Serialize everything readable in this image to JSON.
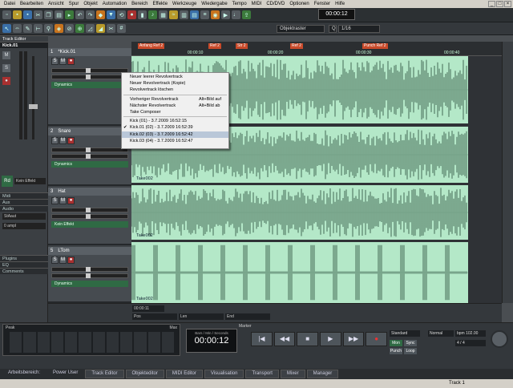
{
  "menu": [
    "Datei",
    "Bearbeiten",
    "Ansicht",
    "Spur",
    "Objekt",
    "Automation",
    "Bereich",
    "Effekte",
    "Werkzeuge",
    "Wiedergabe",
    "Tempo",
    "MIDI",
    "CD/DVD",
    "Optionen",
    "Fenster",
    "Hilfe"
  ],
  "toolbar": {
    "time": "00:00:12",
    "snap_label": "Objektraster",
    "quant_label": "Q",
    "quant_value": "1/16"
  },
  "track_editor": {
    "title": "Track Editor",
    "track_name": "Kick.01",
    "sections": [
      "Midi",
      "Aux",
      "Audio",
      "Plugins",
      "EQ",
      "Comments"
    ],
    "audio_value": "StAaut",
    "vol_value": "0 ampl",
    "kein_effekt": "Kein Effekt",
    "rd_label": "Rd"
  },
  "tracks": [
    {
      "num": "1",
      "name": "*Kick.01",
      "fx": "Dynamics"
    },
    {
      "num": "2",
      "name": "Snare",
      "fx": "Dynamics"
    },
    {
      "num": "3",
      "name": "Hat",
      "fx": "Kein Effekt"
    },
    {
      "num": "5",
      "name": "LTom",
      "fx": "Dynamics"
    }
  ],
  "markers": [
    "Anfang Ref 2",
    "Ref 2",
    "Str 2",
    "Ref 2",
    "Punch Ref 2"
  ],
  "ruler_ticks": [
    "00:00:10",
    "00:00:20",
    "00:00:30",
    "00:00:40"
  ],
  "takes": [
    "Take002",
    "Take002",
    "Take002",
    "Take002"
  ],
  "context_menu": [
    {
      "label": "Neuer leerer Revolvertrack",
      "shortcut": ""
    },
    {
      "label": "Neuer Revolvertrack (Kopie)",
      "shortcut": ""
    },
    {
      "label": "Revolvertrack löschen",
      "shortcut": ""
    },
    {
      "sep": true
    },
    {
      "label": "Vorheriger Revolvertrack",
      "shortcut": "Alt+Bild auf"
    },
    {
      "label": "Nächster Revolvertrack",
      "shortcut": "Alt+Bild ab"
    },
    {
      "label": "Take Composer",
      "shortcut": ""
    },
    {
      "sep": true
    },
    {
      "label": "Kick      (01) - 3.7.2009  16:52:15",
      "shortcut": ""
    },
    {
      "label": "Kick.01 (02) - 3.7.2009  16:52:39",
      "shortcut": "",
      "checked": true
    },
    {
      "label": "Kick.02 (03) - 3.7.2009  16:52:42",
      "shortcut": "",
      "selected": true
    },
    {
      "label": "Kick.03 (04) - 3.7.2009  16:52:47",
      "shortcut": ""
    }
  ],
  "positions": {
    "pos_label": "Pos",
    "len_label": "Len",
    "end_label": "End",
    "pos_value": "00:00:11"
  },
  "transport": {
    "time": "00:00:12",
    "small_label": "Bars / Min / Seconds",
    "standard": "Standard",
    "normal": "Normal",
    "bpm": "bpm 102.00",
    "sig": "4 / 4",
    "mon": "Mon",
    "punch": "Punch",
    "loop": "Loop",
    "sync": "Sync",
    "marker": "Marker",
    "peak": "Peak",
    "max": "Max"
  },
  "bottom_tabs": [
    "Arbeitsbereich:",
    "Power User",
    "Track Editor",
    "Objekteditor",
    "MIDI Editor",
    "Visualisation",
    "Transport",
    "Mixer",
    "Manager"
  ],
  "status": "Track 1"
}
